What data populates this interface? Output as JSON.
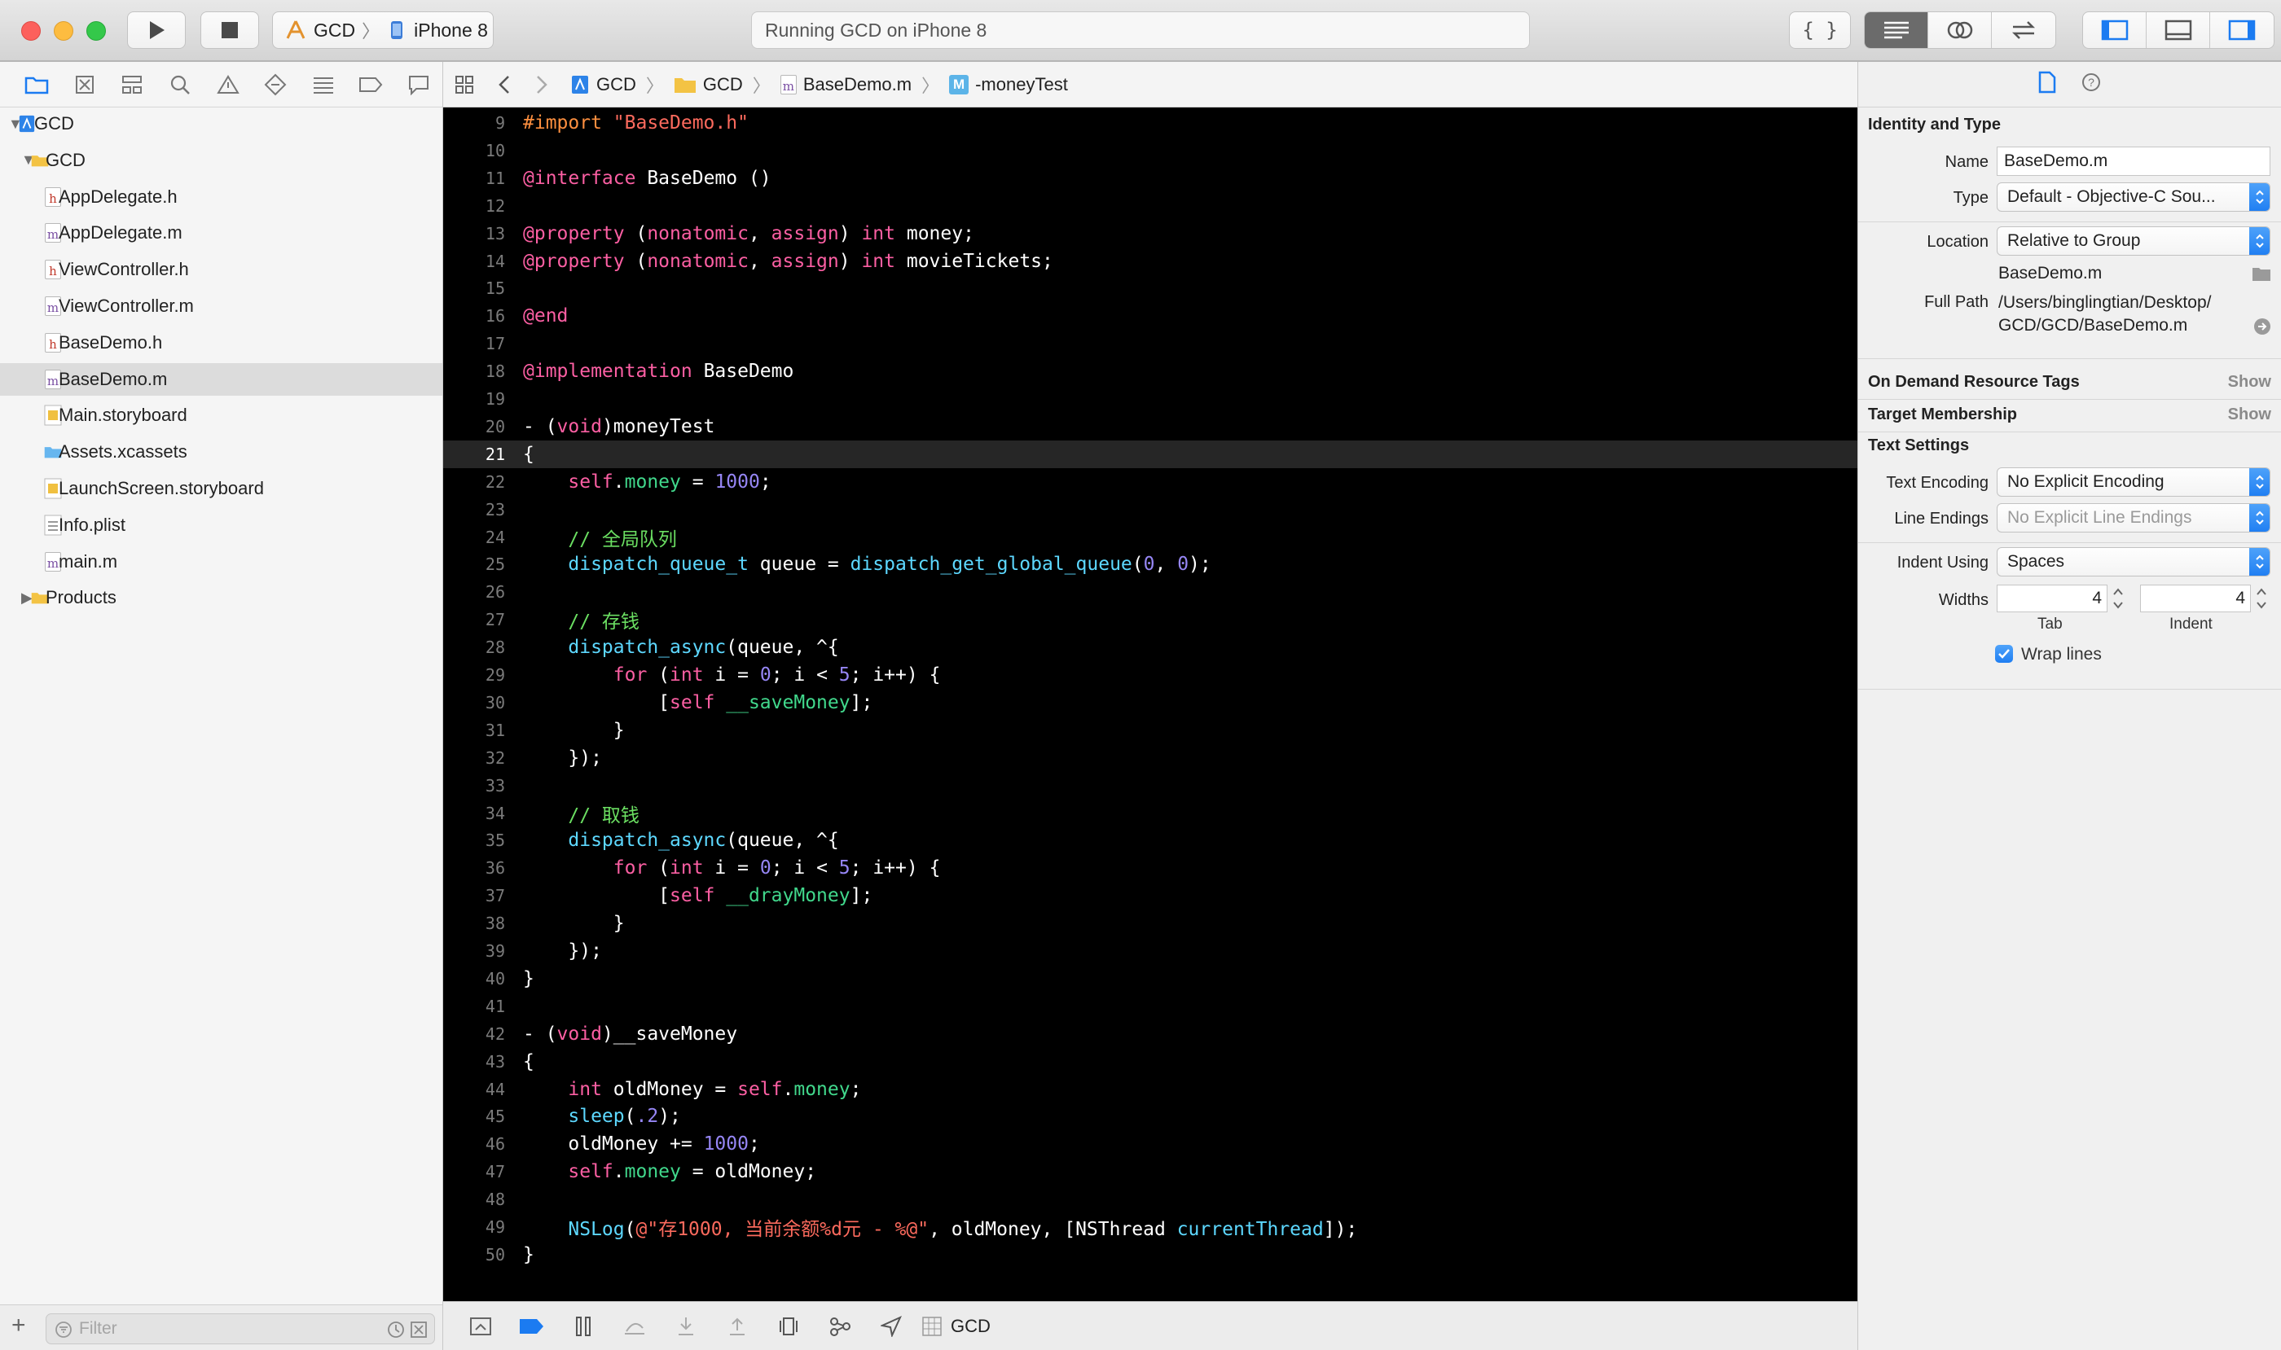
{
  "toolbar": {
    "scheme_target": "GCD",
    "scheme_device": "iPhone 8",
    "activity": "Running GCD on iPhone 8"
  },
  "navigator": {
    "items": [
      {
        "label": "GCD",
        "icon": "project-icon",
        "level": 0,
        "disclosure": "open"
      },
      {
        "label": "GCD",
        "icon": "folder-icon",
        "level": 1,
        "disclosure": "open"
      },
      {
        "label": "AppDelegate.h",
        "icon": "header-file-icon",
        "level": 2
      },
      {
        "label": "AppDelegate.m",
        "icon": "objc-file-icon",
        "level": 2
      },
      {
        "label": "ViewController.h",
        "icon": "header-file-icon",
        "level": 2
      },
      {
        "label": "ViewController.m",
        "icon": "objc-file-icon",
        "level": 2
      },
      {
        "label": "BaseDemo.h",
        "icon": "header-file-icon",
        "level": 2
      },
      {
        "label": "BaseDemo.m",
        "icon": "objc-file-icon",
        "level": 2,
        "selected": true
      },
      {
        "label": "Main.storyboard",
        "icon": "storyboard-icon",
        "level": 2
      },
      {
        "label": "Assets.xcassets",
        "icon": "assets-folder-icon",
        "level": 2
      },
      {
        "label": "LaunchScreen.storyboard",
        "icon": "storyboard-icon",
        "level": 2
      },
      {
        "label": "Info.plist",
        "icon": "plist-icon",
        "level": 2
      },
      {
        "label": "main.m",
        "icon": "objc-file-icon",
        "level": 2
      },
      {
        "label": "Products",
        "icon": "folder-icon",
        "level": 1,
        "disclosure": "closed"
      }
    ],
    "filter_placeholder": "Filter"
  },
  "jumpbar": {
    "crumbs": [
      "GCD",
      "GCD",
      "BaseDemo.m",
      "-moneyTest"
    ]
  },
  "editor": {
    "current_line": 21,
    "lines": [
      {
        "n": "9",
        "t": [
          [
            "#import ",
            "pre"
          ],
          [
            "\"BaseDemo.h\"",
            "str"
          ]
        ]
      },
      {
        "n": "10",
        "t": []
      },
      {
        "n": "11",
        "t": [
          [
            "@interface",
            "kw"
          ],
          [
            " BaseDemo ()",
            "plain"
          ]
        ]
      },
      {
        "n": "12",
        "t": []
      },
      {
        "n": "13",
        "t": [
          [
            "@property",
            "kw"
          ],
          [
            " (",
            "plain"
          ],
          [
            "nonatomic",
            "kw"
          ],
          [
            ", ",
            "plain"
          ],
          [
            "assign",
            "kw"
          ],
          [
            ") ",
            "plain"
          ],
          [
            "int",
            "kw"
          ],
          [
            " money;",
            "plain"
          ]
        ]
      },
      {
        "n": "14",
        "t": [
          [
            "@property",
            "kw"
          ],
          [
            " (",
            "plain"
          ],
          [
            "nonatomic",
            "kw"
          ],
          [
            ", ",
            "plain"
          ],
          [
            "assign",
            "kw"
          ],
          [
            ") ",
            "plain"
          ],
          [
            "int",
            "kw"
          ],
          [
            " movieTickets;",
            "plain"
          ]
        ]
      },
      {
        "n": "15",
        "t": []
      },
      {
        "n": "16",
        "t": [
          [
            "@end",
            "kw"
          ]
        ]
      },
      {
        "n": "17",
        "t": []
      },
      {
        "n": "18",
        "t": [
          [
            "@implementation",
            "kw"
          ],
          [
            " BaseDemo",
            "plain"
          ]
        ]
      },
      {
        "n": "19",
        "t": []
      },
      {
        "n": "20",
        "t": [
          [
            "- (",
            "plain"
          ],
          [
            "void",
            "kw"
          ],
          [
            ")moneyTest",
            "plain"
          ]
        ]
      },
      {
        "n": "21",
        "t": [
          [
            "{",
            "plain"
          ]
        ]
      },
      {
        "n": "22",
        "t": [
          [
            "    ",
            "plain"
          ],
          [
            "self",
            "kw"
          ],
          [
            ".",
            "plain"
          ],
          [
            "money",
            "prop"
          ],
          [
            " = ",
            "plain"
          ],
          [
            "1000",
            "num"
          ],
          [
            ";",
            "plain"
          ]
        ]
      },
      {
        "n": "23",
        "t": []
      },
      {
        "n": "24",
        "t": [
          [
            "    // 全局队列",
            "com"
          ]
        ]
      },
      {
        "n": "25",
        "t": [
          [
            "    ",
            "plain"
          ],
          [
            "dispatch_queue_t",
            "type"
          ],
          [
            " queue = ",
            "plain"
          ],
          [
            "dispatch_get_global_queue",
            "type"
          ],
          [
            "(",
            "plain"
          ],
          [
            "0",
            "num"
          ],
          [
            ", ",
            "plain"
          ],
          [
            "0",
            "num"
          ],
          [
            ");",
            "plain"
          ]
        ]
      },
      {
        "n": "26",
        "t": []
      },
      {
        "n": "27",
        "t": [
          [
            "    // 存钱",
            "com"
          ]
        ]
      },
      {
        "n": "28",
        "t": [
          [
            "    ",
            "plain"
          ],
          [
            "dispatch_async",
            "type"
          ],
          [
            "(queue, ^{",
            "plain"
          ]
        ]
      },
      {
        "n": "29",
        "t": [
          [
            "        ",
            "plain"
          ],
          [
            "for",
            "kw"
          ],
          [
            " (",
            "plain"
          ],
          [
            "int",
            "kw"
          ],
          [
            " i = ",
            "plain"
          ],
          [
            "0",
            "num"
          ],
          [
            "; i < ",
            "plain"
          ],
          [
            "5",
            "num"
          ],
          [
            "; i++) {",
            "plain"
          ]
        ]
      },
      {
        "n": "30",
        "t": [
          [
            "            [",
            "plain"
          ],
          [
            "self",
            "kw"
          ],
          [
            " ",
            "plain"
          ],
          [
            "__saveMoney",
            "prop"
          ],
          [
            "];",
            "plain"
          ]
        ]
      },
      {
        "n": "31",
        "t": [
          [
            "        }",
            "plain"
          ]
        ]
      },
      {
        "n": "32",
        "t": [
          [
            "    });",
            "plain"
          ]
        ]
      },
      {
        "n": "33",
        "t": []
      },
      {
        "n": "34",
        "t": [
          [
            "    // 取钱",
            "com"
          ]
        ]
      },
      {
        "n": "35",
        "t": [
          [
            "    ",
            "plain"
          ],
          [
            "dispatch_async",
            "type"
          ],
          [
            "(queue, ^{",
            "plain"
          ]
        ]
      },
      {
        "n": "36",
        "t": [
          [
            "        ",
            "plain"
          ],
          [
            "for",
            "kw"
          ],
          [
            " (",
            "plain"
          ],
          [
            "int",
            "kw"
          ],
          [
            " i = ",
            "plain"
          ],
          [
            "0",
            "num"
          ],
          [
            "; i < ",
            "plain"
          ],
          [
            "5",
            "num"
          ],
          [
            "; i++) {",
            "plain"
          ]
        ]
      },
      {
        "n": "37",
        "t": [
          [
            "            [",
            "plain"
          ],
          [
            "self",
            "kw"
          ],
          [
            " ",
            "plain"
          ],
          [
            "__drayMoney",
            "prop"
          ],
          [
            "];",
            "plain"
          ]
        ]
      },
      {
        "n": "38",
        "t": [
          [
            "        }",
            "plain"
          ]
        ]
      },
      {
        "n": "39",
        "t": [
          [
            "    });",
            "plain"
          ]
        ]
      },
      {
        "n": "40",
        "t": [
          [
            "}",
            "plain"
          ]
        ]
      },
      {
        "n": "41",
        "t": []
      },
      {
        "n": "42",
        "t": [
          [
            "- (",
            "plain"
          ],
          [
            "void",
            "kw"
          ],
          [
            ")__saveMoney",
            "plain"
          ]
        ]
      },
      {
        "n": "43",
        "t": [
          [
            "{",
            "plain"
          ]
        ]
      },
      {
        "n": "44",
        "t": [
          [
            "    ",
            "plain"
          ],
          [
            "int",
            "kw"
          ],
          [
            " oldMoney = ",
            "plain"
          ],
          [
            "self",
            "kw"
          ],
          [
            ".",
            "plain"
          ],
          [
            "money",
            "prop"
          ],
          [
            ";",
            "plain"
          ]
        ]
      },
      {
        "n": "45",
        "t": [
          [
            "    ",
            "plain"
          ],
          [
            "sleep",
            "type"
          ],
          [
            "(",
            "plain"
          ],
          [
            ".2",
            "num"
          ],
          [
            ");",
            "plain"
          ]
        ]
      },
      {
        "n": "46",
        "t": [
          [
            "    oldMoney += ",
            "plain"
          ],
          [
            "1000",
            "num"
          ],
          [
            ";",
            "plain"
          ]
        ]
      },
      {
        "n": "47",
        "t": [
          [
            "    ",
            "plain"
          ],
          [
            "self",
            "kw"
          ],
          [
            ".",
            "plain"
          ],
          [
            "money",
            "prop"
          ],
          [
            " = oldMoney;",
            "plain"
          ]
        ]
      },
      {
        "n": "48",
        "t": []
      },
      {
        "n": "49",
        "t": [
          [
            "    ",
            "plain"
          ],
          [
            "NSLog",
            "type"
          ],
          [
            "(",
            "plain"
          ],
          [
            "@\"存1000, 当前余额%d元 - %@\"",
            "str"
          ],
          [
            ", oldMoney, [NSThread ",
            "plain"
          ],
          [
            "currentThread",
            "type"
          ],
          [
            "]);",
            "plain"
          ]
        ]
      },
      {
        "n": "50",
        "t": [
          [
            "}",
            "plain"
          ]
        ]
      }
    ]
  },
  "debugbar": {
    "target": "GCD"
  },
  "inspector": {
    "identity_title": "Identity and Type",
    "name_label": "Name",
    "name_value": "BaseDemo.m",
    "type_label": "Type",
    "type_value": "Default - Objective-C Sou...",
    "location_label": "Location",
    "location_value": "Relative to Group",
    "location_file": "BaseDemo.m",
    "fullpath_label": "Full Path",
    "fullpath_line1": "/Users/binglingtian/Desktop/",
    "fullpath_line2": "GCD/GCD/BaseDemo.m",
    "odr_title": "On Demand Resource Tags",
    "odr_show": "Show",
    "target_title": "Target Membership",
    "target_show": "Show",
    "text_settings_title": "Text Settings",
    "encoding_label": "Text Encoding",
    "encoding_value": "No Explicit Encoding",
    "endings_label": "Line Endings",
    "endings_value": "No Explicit Line Endings",
    "indent_label": "Indent Using",
    "indent_value": "Spaces",
    "widths_label": "Widths",
    "tab_width": "4",
    "indent_width": "4",
    "tab_label": "Tab",
    "indent_sublabel": "Indent",
    "wrap_label": "Wrap lines"
  }
}
